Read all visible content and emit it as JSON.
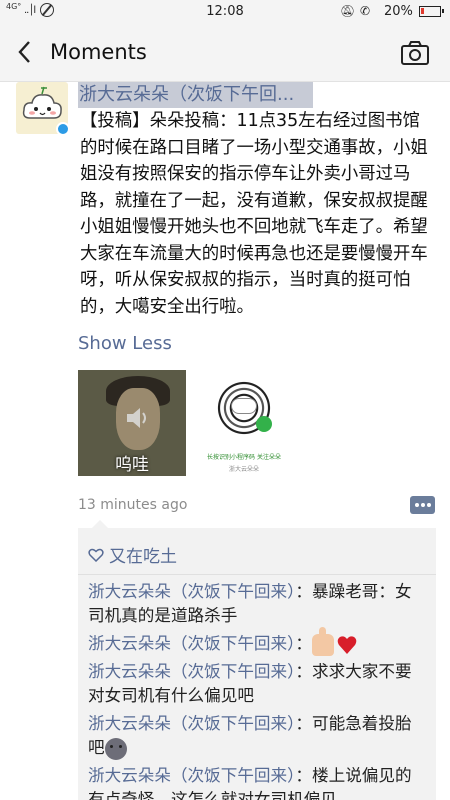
{
  "status_bar": {
    "network": "4G°",
    "signal": "..│l",
    "time": "12:08",
    "battery_percent": "20%",
    "battery_level": 0.2
  },
  "header": {
    "title": "Moments"
  },
  "post": {
    "author": "浙大云朵朵（次饭下午回...",
    "text": "【投稿】朵朵投稿：11点35左右经过图书馆的时候在路口目睹了一场小型交通事故，小姐姐没有按照保安的指示停车让外卖小哥过马路，就撞在了一起，没有道歉，保安叔叔提醒小姐姐慢慢开她头也不回地就飞车走了。希望大家在车流量大的时候再急也还是要慢慢开车呀，听从保安叔叔的指示，当时真的挺可怕的，大噶安全出行啦。",
    "show_less": "Show Less",
    "image1_caption": "呜哇",
    "image2_line1": "长按识别小程序码 关注朵朵",
    "image2_line2": "浙大云朵朵",
    "timestamp": "13 minutes ago"
  },
  "likes": {
    "names": "又在吃土"
  },
  "comments": [
    {
      "name": "浙大云朵朵（次饭下午回来）",
      "text": "：暴躁老哥：女司机真的是道路杀手"
    },
    {
      "name": "浙大云朵朵（次饭下午回来）",
      "text": "："
    },
    {
      "name": "浙大云朵朵（次饭下午回来）",
      "text": "：求求大家不要对女司机有什么偏见吧"
    },
    {
      "name": "浙大云朵朵（次饭下午回来）",
      "text": "：可能急着投胎吧"
    },
    {
      "name": "浙大云朵朵（次饭下午回来）",
      "text": "：楼上说偏见的有点奇怪，这怎么就对女司机偏见"
    }
  ],
  "colors": {
    "link_blue": "#576b95",
    "header_bg": "#f4f4f4",
    "comment_bg": "#f2f2f2",
    "battery_red": "#e03b2f"
  },
  "icons": [
    "back-arrow-icon",
    "camera-icon",
    "heart-outline-icon",
    "comment-dots-icon",
    "verified-badge-icon"
  ]
}
